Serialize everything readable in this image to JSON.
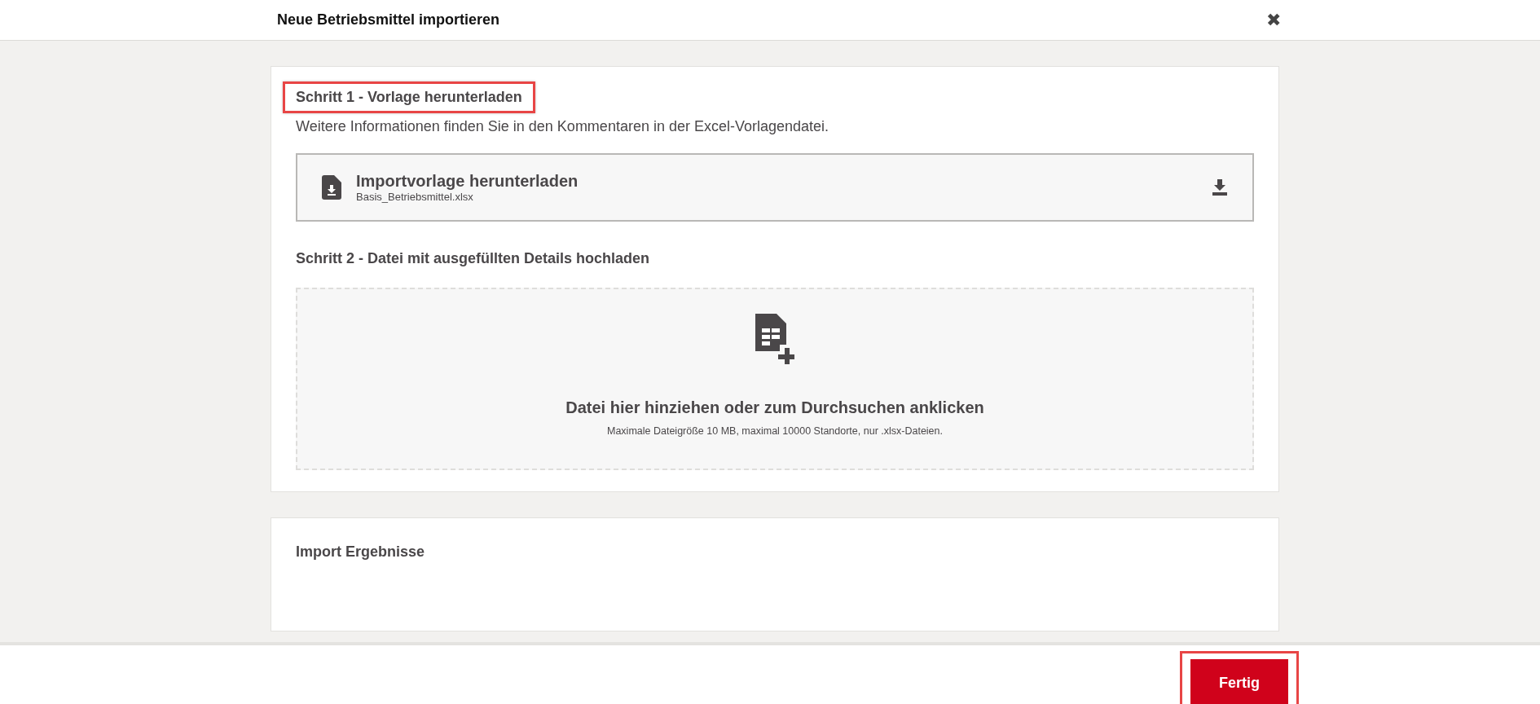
{
  "dialog": {
    "title": "Neue Betriebsmittel importieren",
    "close": "✖"
  },
  "step1": {
    "heading": "Schritt 1 - Vorlage herunterladen",
    "highlighted": true,
    "description": "Weitere Informationen finden Sie in den Kommentaren in der Excel-Vorlagendatei.",
    "download": {
      "title": "Importvorlage herunterladen",
      "filename": "Basis_Betriebsmittel.xlsx"
    }
  },
  "step2": {
    "heading": "Schritt 2 - Datei mit ausgefüllten Details hochladen",
    "highlighted": false,
    "dropzone": {
      "prompt": "Datei hier hinziehen oder zum Durchsuchen anklicken",
      "hint": "Maximale Dateigröße 10 MB, maximal 10000 Standorte, nur .xlsx-Dateien."
    }
  },
  "results": {
    "heading": "Import Ergebnisse"
  },
  "footer": {
    "button": "Fertig",
    "highlighted": true
  }
}
